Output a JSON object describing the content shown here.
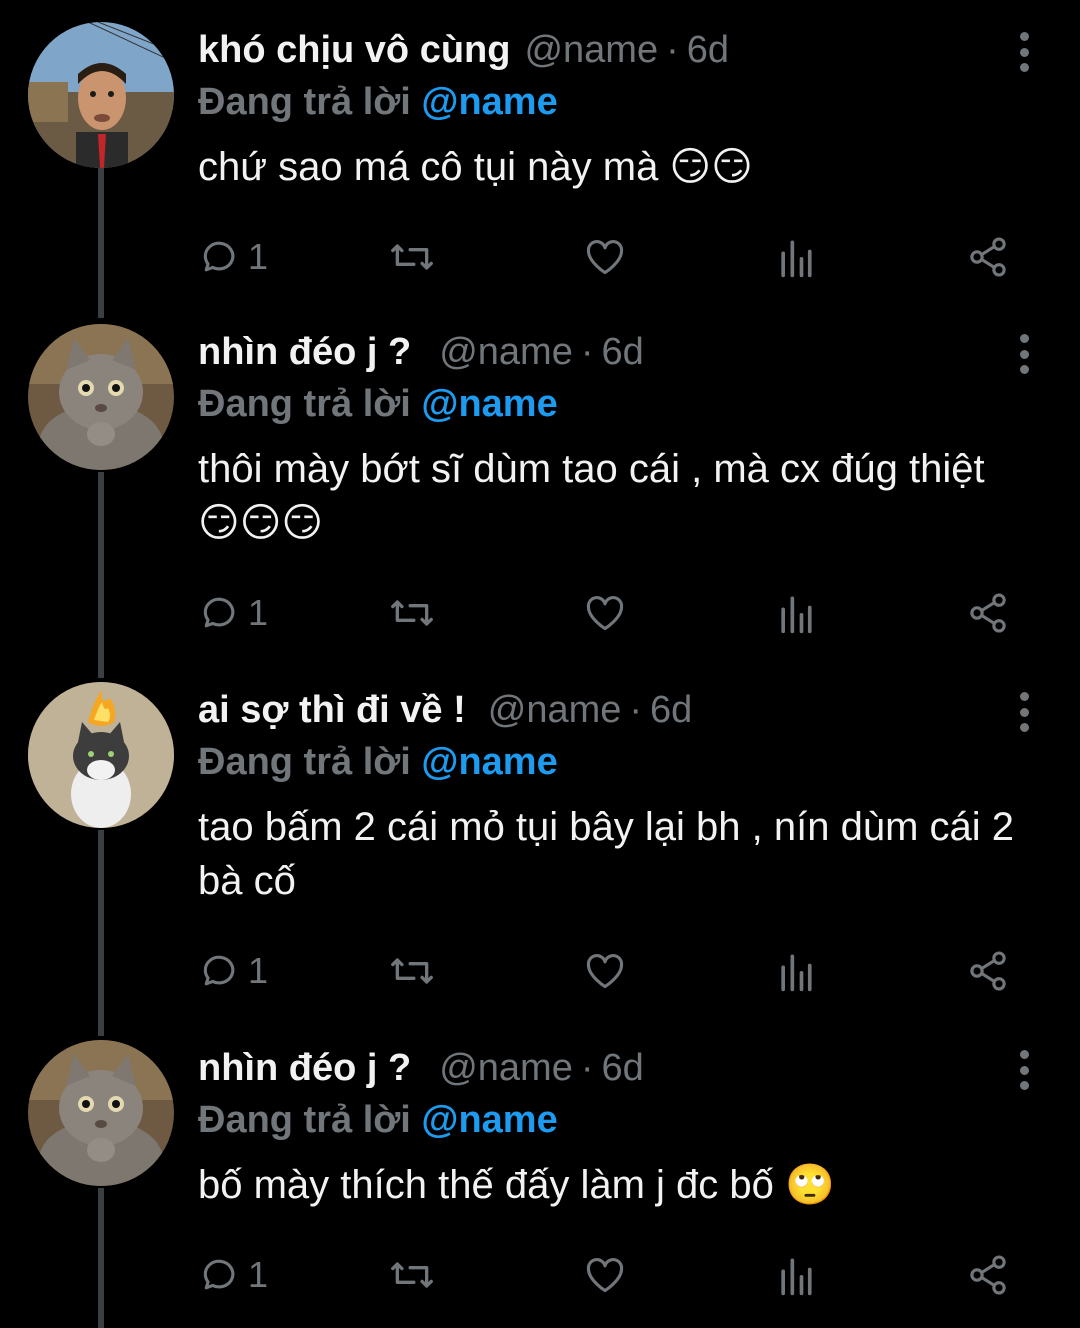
{
  "colors": {
    "background": "#000000",
    "text": "#f2f2f2",
    "muted": "#71767b",
    "link": "#1d9bf0",
    "thread_line": "#3a3f44"
  },
  "icons": {
    "more": "more-vertical-icon",
    "reply": "reply-bubble-icon",
    "retweet": "retweet-icon",
    "like": "heart-icon",
    "views": "bar-chart-icon",
    "share": "share-icon"
  },
  "tweets": [
    {
      "display_name": "khó chịu vô cùng",
      "handle": "@name",
      "separator": "·",
      "time": "6d",
      "reply_prefix": "Đang trả lời",
      "reply_handle": "@name",
      "text": "chứ sao má cô tụi này mà 😏😏",
      "reply_count": "1",
      "avatar": "man-avatar"
    },
    {
      "display_name": "nhìn đéo j ?",
      "handle": "@name",
      "separator": "·",
      "time": "6d",
      "reply_prefix": "Đang trả lời",
      "reply_handle": "@name",
      "text": "thôi mày bớt sĩ dùm tao cái , mà cx đúg thiệt 😏😏😏",
      "reply_count": "1",
      "avatar": "gray-cat-avatar"
    },
    {
      "display_name": "ai sợ thì đi về !",
      "handle": "@name",
      "separator": "·",
      "time": "6d",
      "reply_prefix": "Đang trả lời",
      "reply_handle": "@name",
      "text": "tao bấm 2 cái mỏ tụi bây lại bh , nín dùm cái 2 bà cố",
      "reply_count": "1",
      "avatar": "fire-cat-avatar"
    },
    {
      "display_name": "nhìn đéo j ?",
      "handle": "@name",
      "separator": "·",
      "time": "6d",
      "reply_prefix": "Đang trả lời",
      "reply_handle": "@name",
      "text": "bố mày thích thế đấy làm j đc bố 🙄",
      "reply_count": "1",
      "avatar": "gray-cat-avatar"
    }
  ]
}
